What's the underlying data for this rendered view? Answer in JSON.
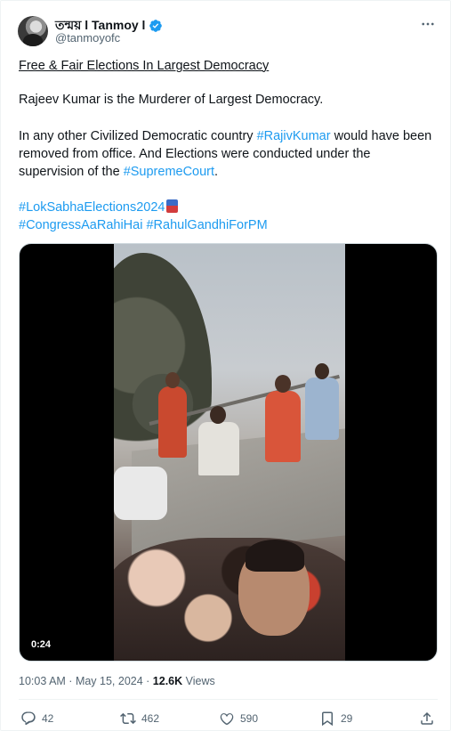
{
  "author": {
    "name": "তন্ময় l Tanmoy l",
    "handle": "@tanmoyofc",
    "verified": true
  },
  "tweet": {
    "line1": "Free & Fair  Elections In Largest Democracy ",
    "para2": "Rajeev Kumar is the Murderer of Largest Democracy.",
    "para3_before": "In any other Civilized Democratic country ",
    "para3_tag1": "#RajivKumar",
    "para3_mid": " would have been removed from office. And Elections were conducted under the supervision of the ",
    "para3_tag2": "#SupremeCourt",
    "para3_end": ".",
    "hashtag1": "#LokSabhaElections2024",
    "hashtag2": "#CongressAaRahiHai",
    "hashtag3": "#RahulGandhiForPM"
  },
  "video": {
    "duration": "0:24"
  },
  "meta": {
    "time": "10:03 AM",
    "separator": " · ",
    "date": "May 15, 2024",
    "views_count": "12.6K",
    "views_label": " Views"
  },
  "actions": {
    "replies": "42",
    "reposts": "462",
    "likes": "590",
    "bookmarks": "29"
  },
  "colors": {
    "link": "#1d9bf0",
    "text": "#0f1419",
    "secondary": "#536471"
  },
  "icons": [
    "verified-badge-icon",
    "more-icon",
    "reply-icon",
    "repost-icon",
    "like-icon",
    "bookmark-icon",
    "share-icon"
  ]
}
